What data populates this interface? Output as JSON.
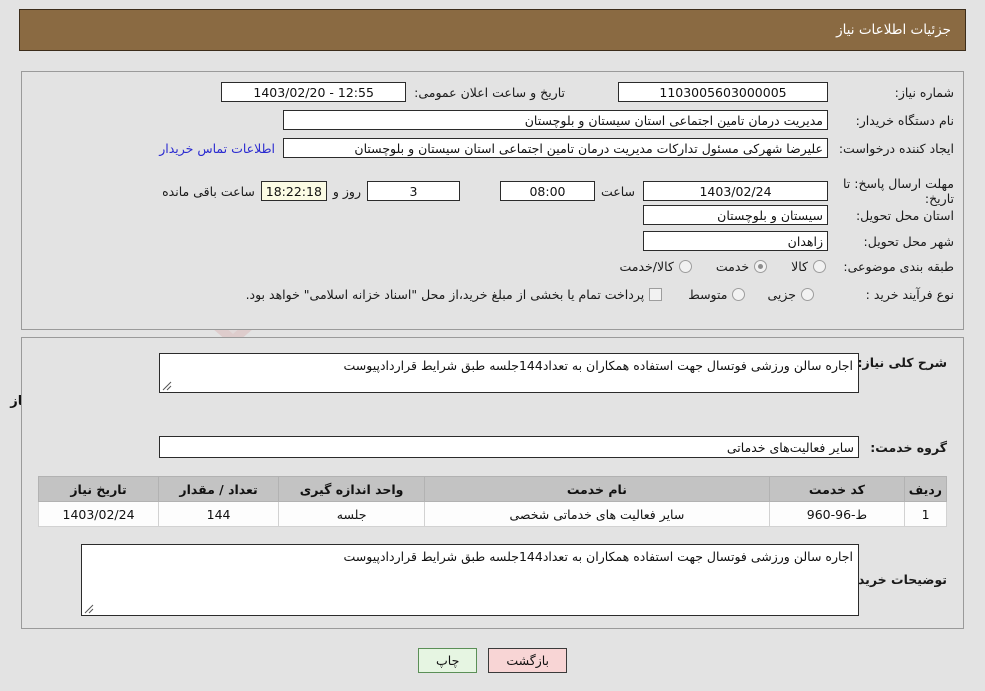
{
  "header": {
    "title": "جزئیات اطلاعات نیاز"
  },
  "watermark": {
    "text": "AriaTender.net"
  },
  "top_panel": {
    "need_number": {
      "label": "شماره نیاز:",
      "value": "1103005603000005"
    },
    "announce": {
      "label": "تاریخ و ساعت اعلان عمومی:",
      "value": "12:55 - 1403/02/20"
    },
    "buyer_org": {
      "label": "نام دستگاه خریدار:",
      "value": "مدیریت درمان تامین اجتماعی استان سیستان و بلوچستان"
    },
    "creator": {
      "label": "ایجاد کننده درخواست:",
      "value": "علیرضا شهرکی مسئول تدارکات مدیریت درمان تامین اجتماعی استان سیستان و بلوچستان",
      "contact_link": "اطلاعات تماس خریدار"
    },
    "deadline": {
      "label": "مهلت ارسال پاسخ: تا تاریخ:",
      "date": "1403/02/24",
      "time_label": "ساعت",
      "time": "08:00",
      "days": "3",
      "days_suffix": "روز و",
      "countdown": "18:22:18",
      "countdown_suffix": "ساعت باقی مانده"
    },
    "province": {
      "label": "استان محل تحویل:",
      "value": "سیستان و بلوچستان"
    },
    "city": {
      "label": "شهر محل تحویل:",
      "value": "زاهدان"
    },
    "category": {
      "label": "طبقه بندی موضوعی:",
      "options": [
        {
          "text": "کالا",
          "checked": false
        },
        {
          "text": "خدمت",
          "checked": true
        },
        {
          "text": "کالا/خدمت",
          "checked": false
        }
      ]
    },
    "process": {
      "label": "نوع فرآیند خرید :",
      "options": [
        {
          "text": "جزیی",
          "checked": false
        },
        {
          "text": "متوسط",
          "checked": false
        }
      ],
      "treasury_checkbox": {
        "checked": false,
        "text": "پرداخت تمام یا بخشی از مبلغ خرید،از محل \"اسناد خزانه اسلامی\" خواهد بود."
      }
    }
  },
  "bottom_panel": {
    "general_desc": {
      "label": "شرح کلی نیاز:",
      "value": "اجاره سالن ورزشی فوتسال جهت استفاده همکاران به تعداد144جلسه طبق شرایط قراردادپیوست"
    },
    "services_title": "اطلاعات خدمات مورد نیاز",
    "service_group": {
      "label": "گروه خدمت:",
      "value": "سایر فعالیت‌های خدماتی"
    },
    "table": {
      "columns": [
        "ردیف",
        "کد خدمت",
        "نام خدمت",
        "واحد اندازه گیری",
        "تعداد / مقدار",
        "تاریخ نیاز"
      ],
      "rows": [
        {
          "row": "1",
          "code": "ط-96-960",
          "name": "سایر فعالیت های خدماتی شخصی",
          "unit": "جلسه",
          "qty": "144",
          "date": "1403/02/24"
        }
      ]
    },
    "buyer_notes": {
      "label": "توضیحات خریدار:",
      "value": "اجاره سالن ورزشی فوتسال جهت استفاده همکاران به تعداد144جلسه طبق شرایط قراردادپیوست"
    }
  },
  "footer": {
    "back_button": "بازگشت",
    "print_button": "چاپ"
  }
}
